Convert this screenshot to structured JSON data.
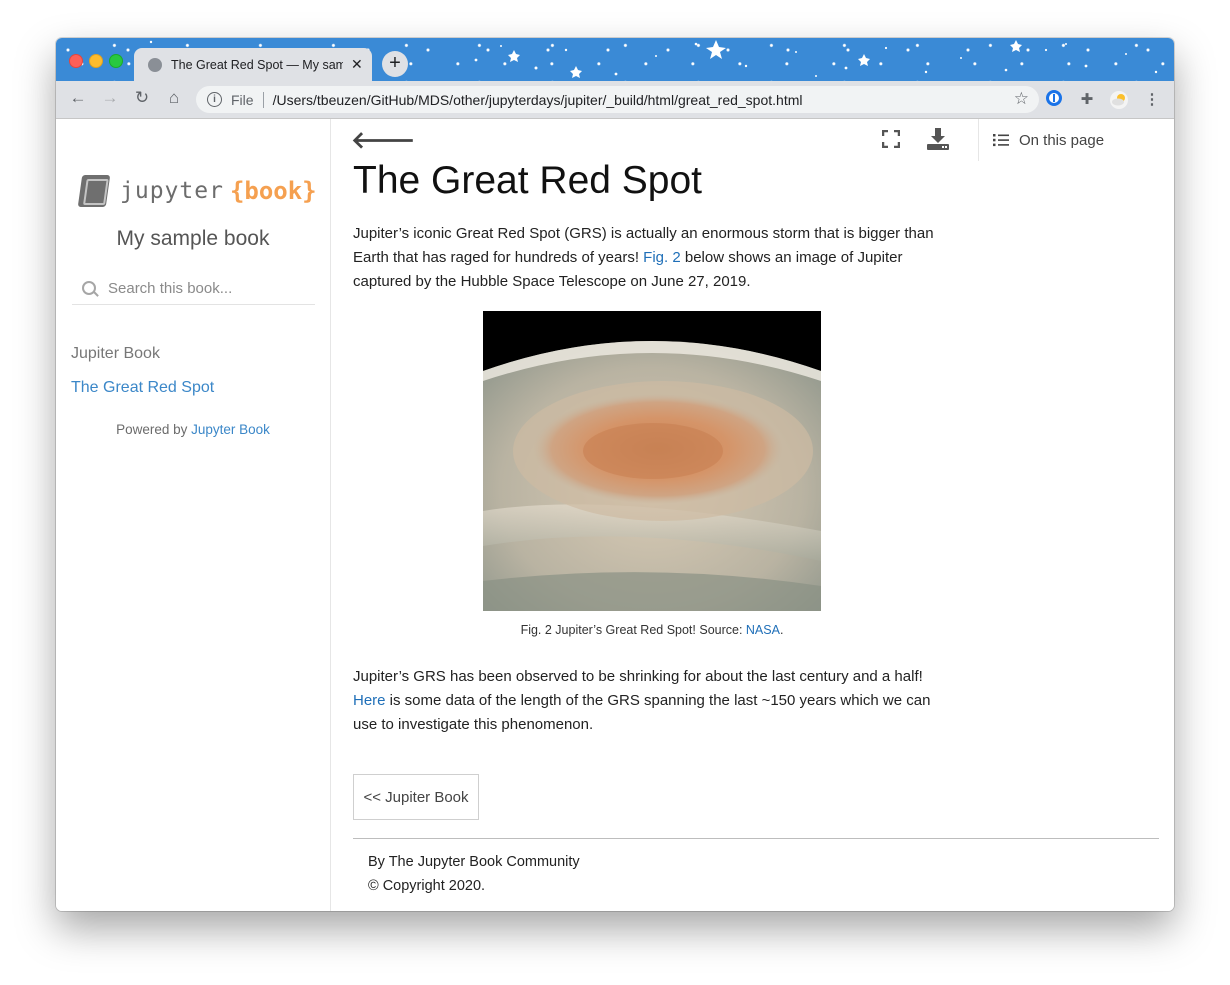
{
  "browser": {
    "tab_title": "The Great Red Spot — My sample book",
    "tab_close": "✕",
    "new_tab": "+",
    "url_prefix": "File",
    "url": "/Users/tbeuzen/GitHub/MDS/other/jupyterdays/jupiter/_build/html/great_red_spot.html"
  },
  "sidebar": {
    "logo_jupyter": "jupyter",
    "logo_book": "{book}",
    "book_title": "My sample book",
    "search_placeholder": "Search this book...",
    "nav_caption": "Jupiter Book",
    "nav_item": "The Great Red Spot",
    "powered_prefix": "Powered by ",
    "powered_link": "Jupyter Book"
  },
  "topbar": {
    "toc_label": "On this page"
  },
  "page": {
    "title": "The Great Red Spot",
    "intro_1": "Jupiter’s iconic Great Red Spot (GRS) is actually an enormous storm that is bigger than Earth that has raged for hundreds of years! ",
    "intro_link": "Fig. 2",
    "intro_2": " below shows an image of Jupiter captured by the Hubble Space Telescope on June 27, 2019.",
    "caption_prefix": "Fig. 2 Jupiter’s Great Red Spot! Source: ",
    "caption_link": "NASA",
    "caption_suffix": ".",
    "para2_1": "Jupiter’s GRS has been observed to be shrinking for about the last century and a half! ",
    "para2_link": "Here",
    "para2_2": " is some data of the length of the GRS spanning the last ~150 years which we can use to investigate this phenomenon.",
    "prev_button": "<< Jupiter Book",
    "footer_line1": "By The Jupyter Book Community",
    "footer_line2": "© Copyright 2020."
  },
  "colors": {
    "titlebar": "#3a8ad6",
    "link": "#1f6fb8",
    "logo_book": "#f5a050"
  }
}
